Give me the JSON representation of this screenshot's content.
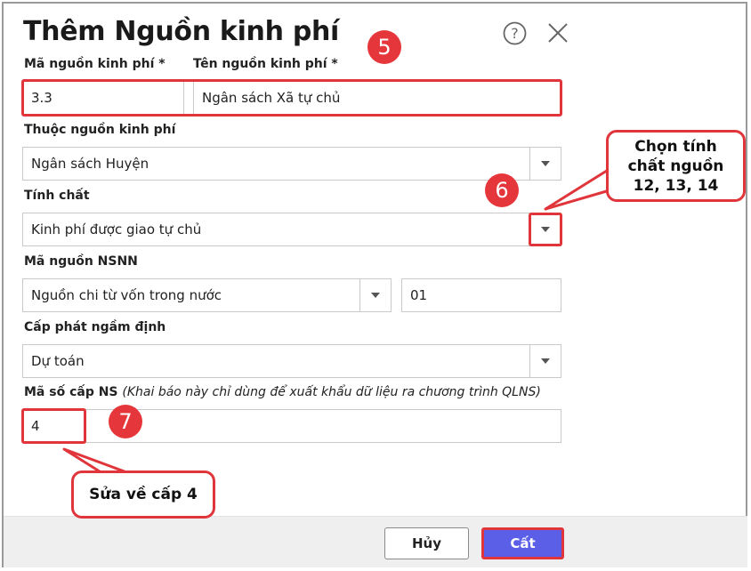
{
  "dialog": {
    "title": "Thêm Nguồn kinh phí"
  },
  "fields": {
    "ma_nguon_label": "Mã nguồn kinh phí *",
    "ma_nguon_value": "3.3",
    "ten_nguon_label": "Tên nguồn kinh phí *",
    "ten_nguon_value": "Ngân sách Xã tự chủ",
    "thuoc_nguon_label": "Thuộc nguồn kinh phí",
    "thuoc_nguon_value": "Ngân sách Huyện",
    "tinh_chat_label": "Tính chất",
    "tinh_chat_value": "Kinh phí được giao tự chủ",
    "ma_nsnn_label": "Mã nguồn NSNN",
    "ma_nsnn_value": "Nguồn chi từ vốn trong nước",
    "ma_nsnn_code": "01",
    "cap_phat_label": "Cấp phát ngầm định",
    "cap_phat_value": "Dự toán",
    "ma_so_cap_label": "Mã số cấp NS",
    "ma_so_cap_note": "(Khai báo này chỉ dùng để xuất khẩu dữ liệu ra chương trình QLNS)",
    "ma_so_cap_value": "4"
  },
  "annotations": {
    "badge_5": "5",
    "badge_6": "6",
    "badge_7": "7",
    "callout_6_line1": "Chọn tính",
    "callout_6_line2": "chất nguồn",
    "callout_6_line3": "12, 13, 14",
    "callout_7": "Sửa về cấp 4"
  },
  "footer": {
    "cancel_label": "Hủy",
    "save_label": "Cất"
  },
  "colors": {
    "accent": "#5b5fe8",
    "annotation_red": "#e0363b"
  }
}
